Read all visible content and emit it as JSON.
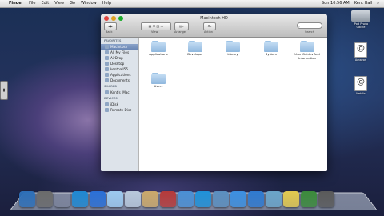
{
  "menubar": {
    "apple": "",
    "items": [
      "Finder",
      "File",
      "Edit",
      "View",
      "Go",
      "Window",
      "Help"
    ],
    "right": [
      "Sun 10:56 AM",
      "Kent Hall"
    ]
  },
  "window": {
    "title": "Macintosh HD",
    "toolbar": {
      "back": "Back",
      "view": "View",
      "arrange": "Arrange",
      "action": "Action",
      "search": "Search"
    },
    "sidebar": {
      "favorites_header": "FAVORITES",
      "favorites": [
        "Macintosh",
        "All My Files",
        "AirDrop",
        "Desktop",
        "kenthall55",
        "Applications",
        "Documents"
      ],
      "shared_header": "SHARED",
      "shared": [
        "Kent's iMac"
      ],
      "devices_header": "DEVICES",
      "devices": [
        "iDisk",
        "Remote Disc"
      ]
    },
    "folders": [
      "Applications",
      "Developer",
      "Library",
      "System",
      "User Guides And Information",
      "Users"
    ]
  },
  "desktop": [
    {
      "label": "iPod Photo Cache"
    },
    {
      "label": "Amazon"
    },
    {
      "label": "Netflix"
    }
  ],
  "dock_colors": [
    "#2d6fb8",
    "#6b6b6b",
    "#444",
    "#1f88d1",
    "#2a6fd6",
    "#9cc9ef",
    "#b7c7db",
    "#caa86a",
    "#b53a3a",
    "#4a8fd4",
    "#1f91d8",
    "#5b8fbf",
    "#3c8fe0",
    "#2f7ad0",
    "#6aa4c9",
    "#e2c94e",
    "#3b8a3b",
    "#5a5a5a"
  ]
}
